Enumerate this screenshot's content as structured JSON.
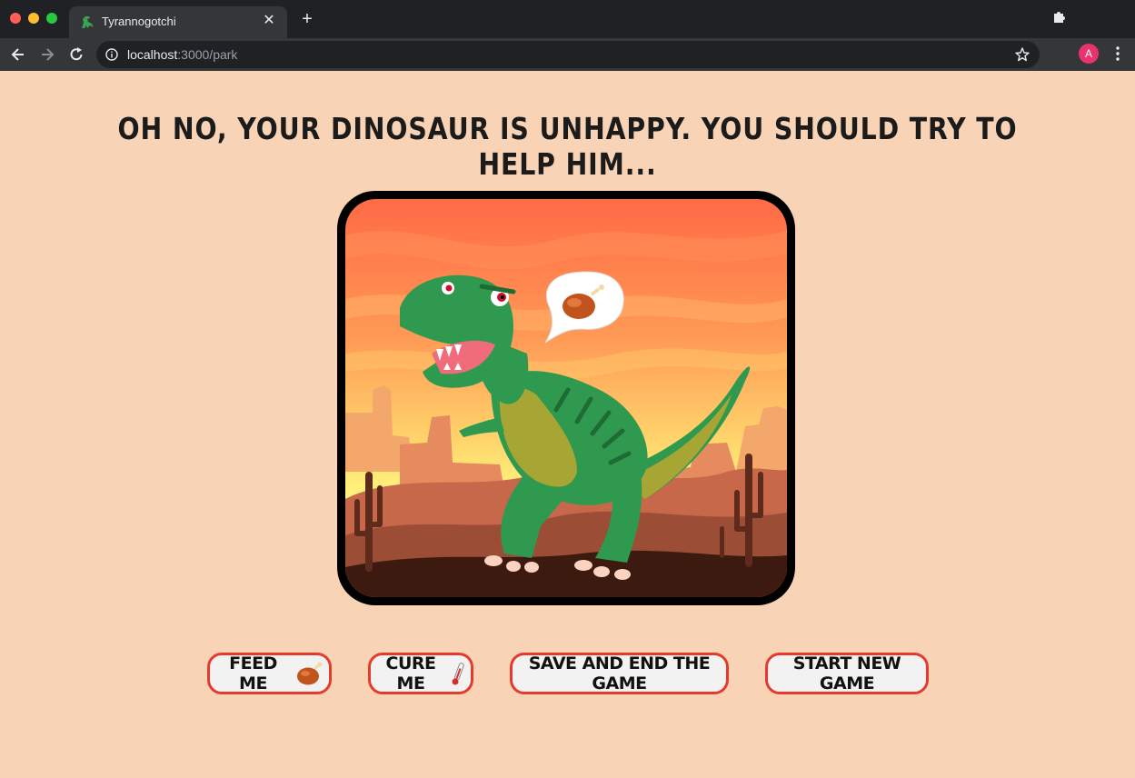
{
  "browser": {
    "tab_title": "Tyrannogotchi",
    "url_host": "localhost",
    "url_path": ":3000/park",
    "profile_initial": "A"
  },
  "page": {
    "headline": "OH NO, YOUR DINOSAUR IS UNHAPPY. YOU SHOULD TRY TO HELP HIM...",
    "speech_bubble_icon": "roast-chicken-icon",
    "buttons": {
      "feed": "FEED ME",
      "cure": "CURE ME",
      "save_end": "SAVE AND END THE GAME",
      "new_game": "START NEW GAME"
    },
    "button_icons": {
      "feed": "roast-chicken-icon",
      "cure": "thermometer-icon"
    }
  },
  "colors": {
    "page_background": "#f8d3b5",
    "button_border": "#e53b2c",
    "dinosaur": "#2f9a4f"
  }
}
